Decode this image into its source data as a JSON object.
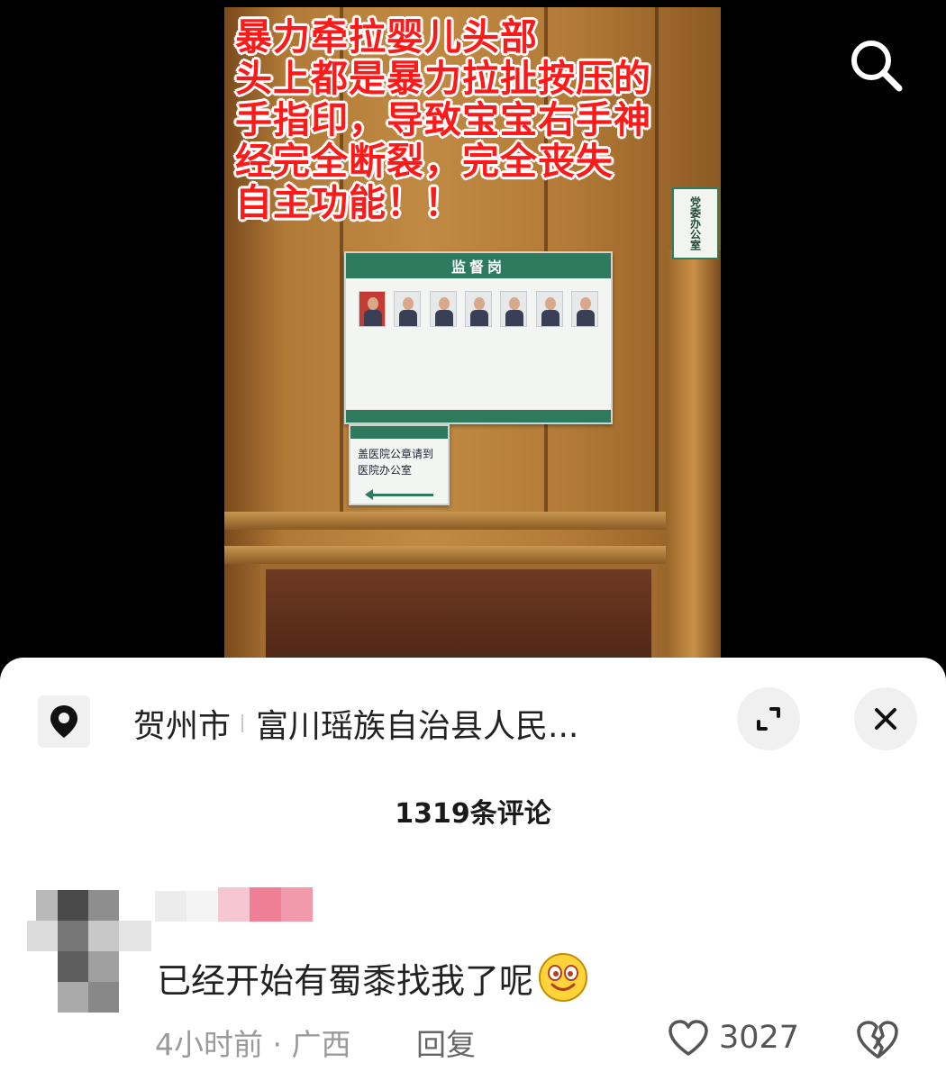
{
  "video": {
    "overlay_lines": [
      "暴力牵拉婴儿头部",
      "头上都是暴力拉扯按压的",
      "手指印，导致宝宝右手神",
      "经完全断裂，完全丧失",
      "自主功能！！"
    ],
    "board_title": "监督岗",
    "notice_text": "盖医院公章请到医院办公室",
    "side_sign": "党委办公室",
    "search_icon": "search-icon"
  },
  "location": {
    "icon": "location-pin-icon",
    "city": "贺州市",
    "place": "富川瑶族自治县人民...",
    "expand_icon": "expand-icon",
    "close_icon": "close-icon"
  },
  "comments_count_label": "1319条评论",
  "comment": {
    "text": "已经开始有蜀黍找我了呢",
    "emoji": "smiley-emoji",
    "meta": "4小时前 · 广西",
    "reply_label": "回复",
    "like_icon": "heart-icon",
    "like_count": "3027",
    "dislike_icon": "broken-heart-icon"
  },
  "colors": {
    "overlay_text": "#ff1a1a",
    "board_green": "#2e7a5f",
    "sheet_bg": "#ffffff"
  }
}
